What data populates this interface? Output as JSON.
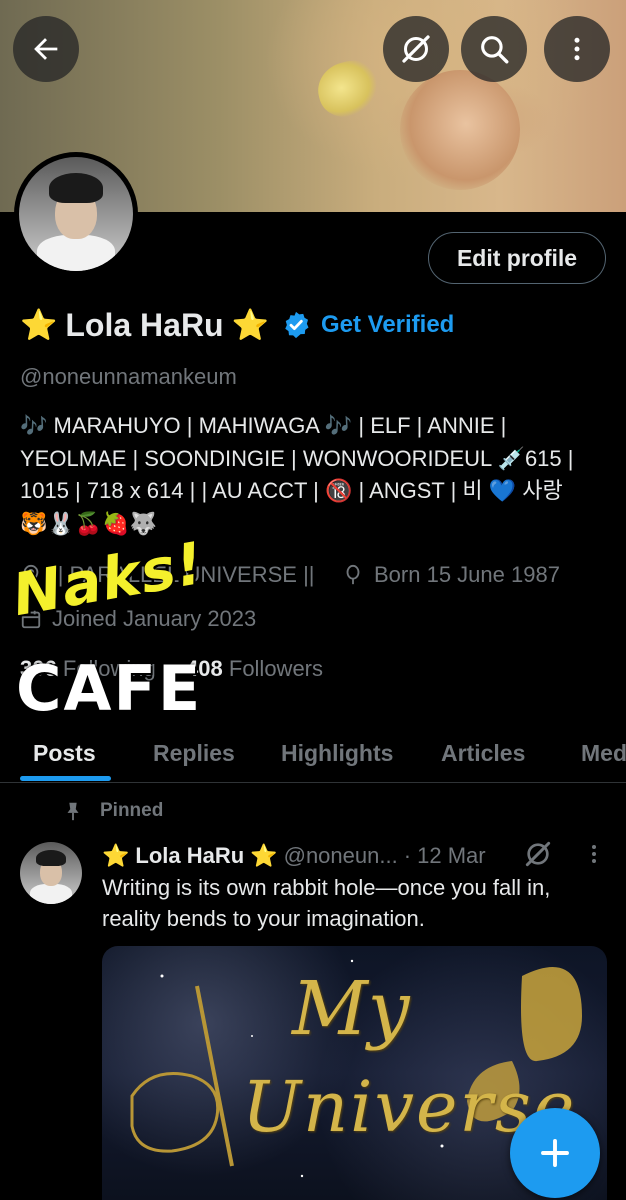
{
  "profile": {
    "display_name": "Lola HaRu",
    "star_glyph": "⭐",
    "get_verified_label": "Get Verified",
    "handle": "@noneunnamankeum",
    "edit_profile_label": "Edit profile",
    "bio_lines": [
      "🎶 MARAHUYO | MAHIWAGA 🎶  | ELF | ANNIE |",
      "YEOLMAE | SOONDINGIE | WONWOORIDEUL 💉615 |",
      "1015 | 718 x 614 |  | AU ACCT | 🔞 | ANGST |  비 💙 사랑",
      "🐯🐰🍒🍓🐺"
    ],
    "location": "|| PARALLEL UNIVERSE ||",
    "birthday": "Born 15 June 1987",
    "joined": "Joined January 2023",
    "following_count": "306",
    "following_label": "Following",
    "followers_count": "408",
    "followers_label": "Followers"
  },
  "watermark": {
    "line1": "Naks!",
    "line2": "CAFE"
  },
  "tabs": [
    {
      "label": "Posts",
      "active": true
    },
    {
      "label": "Replies"
    },
    {
      "label": "Highlights"
    },
    {
      "label": "Articles"
    },
    {
      "label": "Media"
    }
  ],
  "pinned_label": "Pinned",
  "pinned_post": {
    "author_name": "Lola HaRu",
    "handle": "@noneun...",
    "date": "· 12 Mar",
    "text": "Writing is its own rabbit hole—once you fall in, reality bends to your imagination.",
    "image_text_1": "My",
    "image_text_2": "Universe"
  },
  "icons": {
    "back": "arrow-left-icon",
    "grok": "grok-icon",
    "search": "search-icon",
    "more": "more-vertical-icon",
    "verified": "verified-badge-icon",
    "location": "location-icon",
    "birthday": "balloon-icon",
    "calendar": "calendar-icon",
    "pin": "pin-icon",
    "fab": "plus-icon"
  },
  "colors": {
    "accent": "#1d9bf0",
    "background": "#000000",
    "text_primary": "#e7e9ea",
    "text_secondary": "#71767b"
  }
}
